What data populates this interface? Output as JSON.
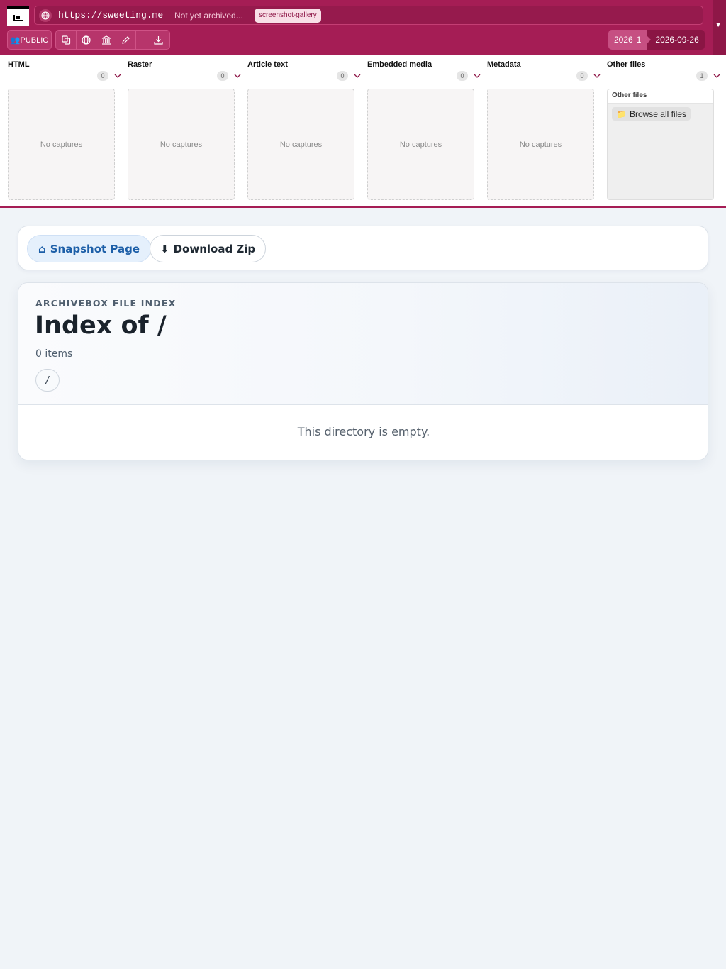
{
  "header": {
    "url": "https://sweeting.me",
    "status": "Not yet archived...",
    "tag": "screenshot-gallery",
    "public_label": "👥PUBLIC",
    "year": "2026",
    "year_count": "1",
    "date": "2026-09-26",
    "toolbar_icons": [
      "copy-icon",
      "globe-icon",
      "archive-icon",
      "edit-icon",
      "dash-icon",
      "download-icon"
    ]
  },
  "captures": {
    "empty_label": "No captures",
    "columns": [
      {
        "title": "HTML",
        "count": "0"
      },
      {
        "title": "Raster",
        "count": "0"
      },
      {
        "title": "Article text",
        "count": "0"
      },
      {
        "title": "Embedded media",
        "count": "0"
      },
      {
        "title": "Metadata",
        "count": "0"
      },
      {
        "title": "Other files",
        "count": "1"
      }
    ],
    "other_files_header": "Other files",
    "browse_label": "Browse all files"
  },
  "nav": {
    "snapshot_label": "Snapshot Page",
    "zip_label": "Download Zip"
  },
  "index": {
    "eyebrow": "ARCHIVEBOX FILE INDEX",
    "title": "Index of /",
    "count": "0 items",
    "breadcrumb": "/",
    "empty_message": "This directory is empty."
  },
  "colors": {
    "header_bg": "#a51d55",
    "accent_blue": "#1d5fa8",
    "page_bg": "#f0f4f8"
  }
}
